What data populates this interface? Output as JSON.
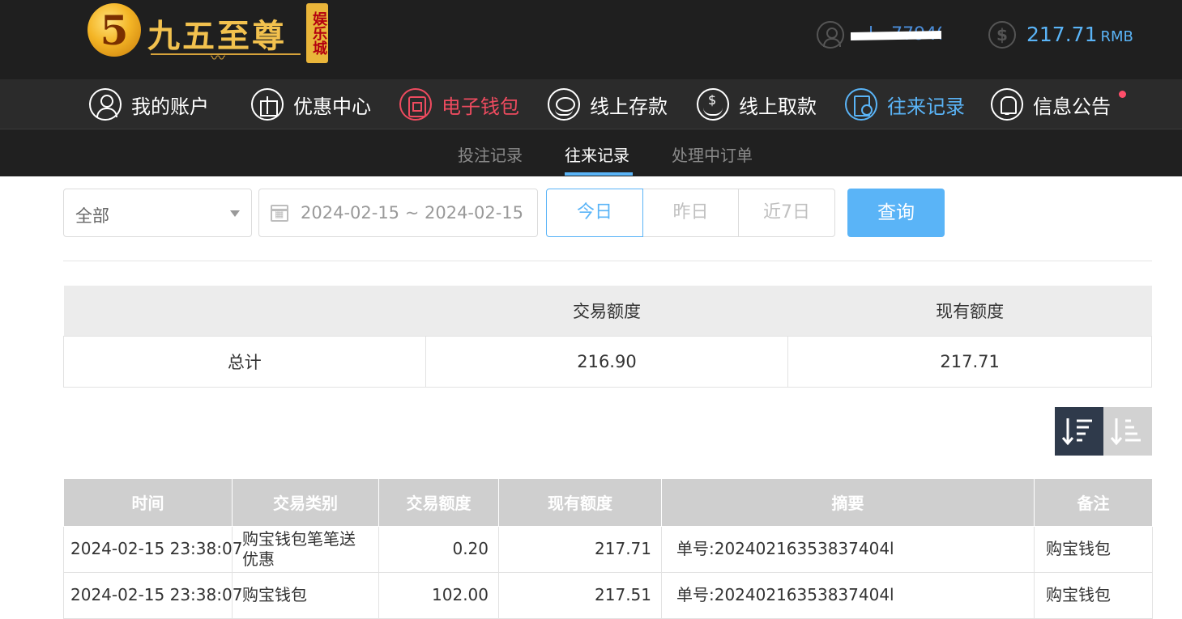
{
  "header": {
    "logo_text": "九五至尊",
    "logo_badge": "5",
    "logo_tag": "娱乐城",
    "username": "…l…77940",
    "balance": "217.71",
    "currency": "RMB"
  },
  "main_nav": [
    {
      "label": "我的账户",
      "icon": "user-icon"
    },
    {
      "label": "优惠中心",
      "icon": "gift-icon"
    },
    {
      "label": "电子钱包",
      "icon": "wallet-icon"
    },
    {
      "label": "线上存款",
      "icon": "deposit-icon"
    },
    {
      "label": "线上取款",
      "icon": "withdraw-icon"
    },
    {
      "label": "往来记录",
      "icon": "record-icon"
    },
    {
      "label": "信息公告",
      "icon": "bell-icon"
    }
  ],
  "sub_nav": [
    {
      "label": "投注记录"
    },
    {
      "label": "往来记录"
    },
    {
      "label": "处理中订单"
    }
  ],
  "filters": {
    "type_value": "全部",
    "date_range": "2024-02-15 ~ 2024-02-15",
    "quick": [
      "今日",
      "昨日",
      "近7日"
    ],
    "search_label": "查询"
  },
  "summary": {
    "headers": [
      "",
      "交易额度",
      "现有额度"
    ],
    "row": {
      "label": "总计",
      "amount": "216.90",
      "balance": "217.71"
    }
  },
  "records": {
    "headers": [
      "时间",
      "交易类别",
      "交易额度",
      "现有额度",
      "摘要",
      "备注"
    ],
    "rows": [
      {
        "time": "2024-02-15 23:38:07",
        "type": "购宝钱包笔笔送优惠",
        "amount": "0.20",
        "balance": "217.71",
        "summary": "单号:20240216353837404l",
        "remark": "购宝钱包"
      },
      {
        "time": "2024-02-15 23:38:07",
        "type": "购宝钱包",
        "amount": "102.00",
        "balance": "217.51",
        "summary": "单号:20240216353837404l",
        "remark": "购宝钱包"
      }
    ]
  },
  "colors": {
    "accent_blue": "#5ab4f7",
    "accent_red": "#ee4b5f",
    "header_bg": "#1f1f1f",
    "nav_bg": "#2b2b2b"
  }
}
